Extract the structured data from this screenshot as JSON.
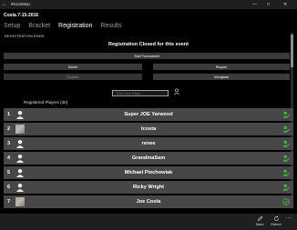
{
  "window": {
    "title": "iRacisMan",
    "back_glyph": "←",
    "minimize_glyph": "—",
    "maximize_glyph": "□",
    "close_glyph": "✕"
  },
  "event": {
    "title": "Costa 7-15-2016"
  },
  "tabs": [
    {
      "label": "Setup",
      "active": false
    },
    {
      "label": "Bracket",
      "active": false
    },
    {
      "label": "Registration",
      "active": true
    },
    {
      "label": "Results",
      "active": false
    }
  ],
  "registration": {
    "ends_label": "REGISTRATION ENDS",
    "closed_heading": "Registration Closed for this event",
    "start_tournament_label": "Start Tournament",
    "delete_label": "Delete",
    "reopen_label": "Reopen",
    "register_label": "Register",
    "unregister_label": "Unregister",
    "search_placeholder": "Enter New Player",
    "registered_label": "Registered Players (30)"
  },
  "players": [
    {
      "number": "1",
      "name": "Super JOE Yarwood",
      "avatar": "person-icon",
      "status": "person-check-icon"
    },
    {
      "number": "2",
      "name": "tcosta",
      "avatar": "photo",
      "status": "person-check-icon"
    },
    {
      "number": "3",
      "name": "renee",
      "avatar": "person-icon",
      "status": "person-check-icon"
    },
    {
      "number": "4",
      "name": "GrandmaSam",
      "avatar": "person-icon",
      "status": "person-check-icon"
    },
    {
      "number": "5",
      "name": "Michael Piechowiak",
      "avatar": "person-icon",
      "status": "person-check-icon"
    },
    {
      "number": "6",
      "name": "Ricky Wright",
      "avatar": "person-icon",
      "status": "person-check-icon"
    },
    {
      "number": "7",
      "name": "Joe Costa",
      "avatar": "photo",
      "status": "check-circle-icon"
    }
  ],
  "appbar": {
    "select_label": "Select",
    "refresh_label": "Refresh",
    "more_glyph": "..."
  },
  "colors": {
    "accent_green": "#3fbf3f",
    "row_bg": "#474747",
    "button_bg": "#3a3a3a"
  }
}
